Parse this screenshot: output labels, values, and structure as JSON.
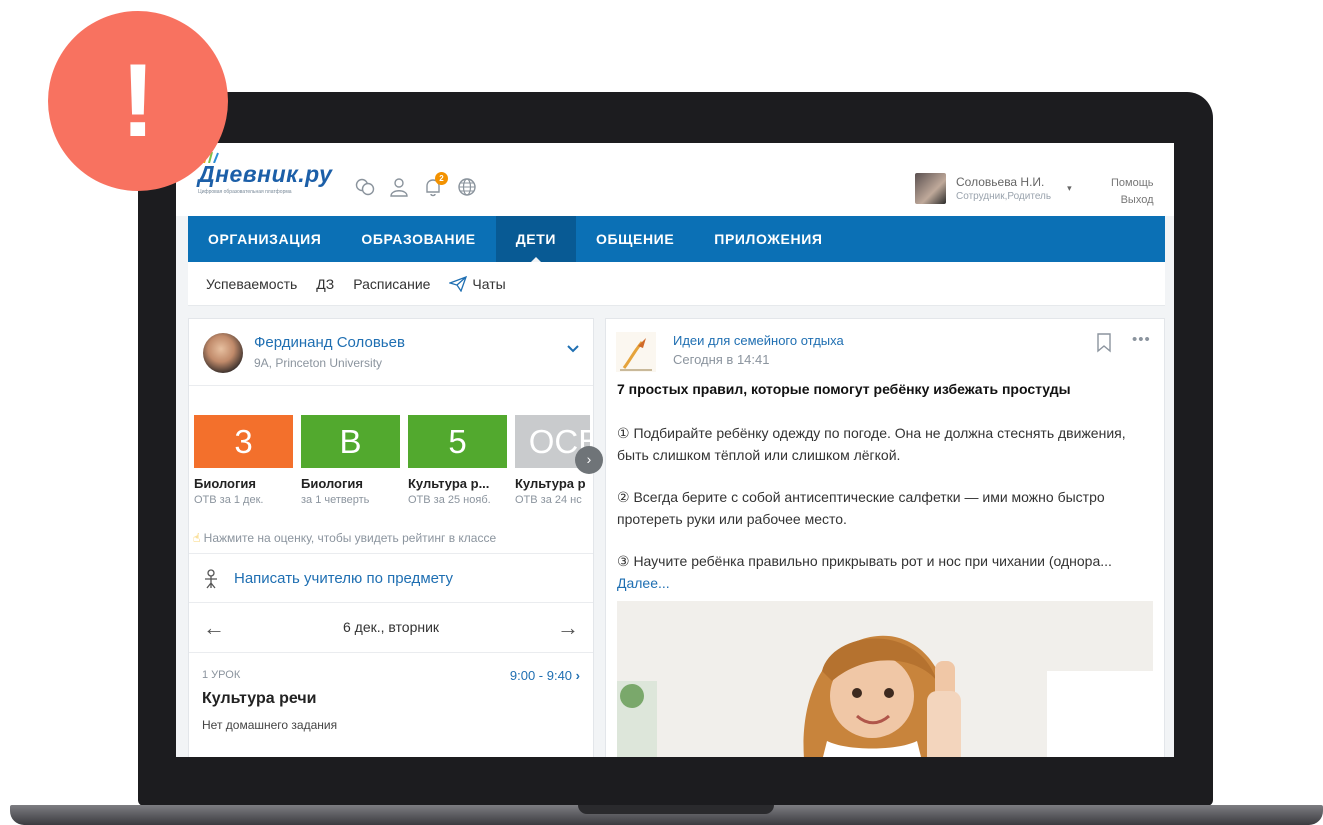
{
  "alert_badge": "!",
  "header": {
    "logo_text": "Дневник.ру",
    "logo_subtitle": "Цифровая образовательная платформа",
    "notifications_count": "2",
    "user_name": "Соловьева Н.И.",
    "user_role": "Сотрудник,Родитель",
    "help": "Помощь",
    "logout": "Выход"
  },
  "nav": {
    "items": [
      "ОРГАНИЗАЦИЯ",
      "ОБРАЗОВАНИЕ",
      "ДЕТИ",
      "ОБЩЕНИЕ",
      "ПРИЛОЖЕНИЯ"
    ],
    "active": "ДЕТИ"
  },
  "subnav": {
    "items": [
      "Успеваемость",
      "ДЗ",
      "Расписание",
      "Чаты"
    ]
  },
  "student": {
    "name": "Фердинанд Соловьев",
    "school": "9А, Princeton University"
  },
  "grades": [
    {
      "mark": "3",
      "subject": "Биология",
      "period": "ОТВ за 1 дек.",
      "color": "#f3702c"
    },
    {
      "mark": "B",
      "subject": "Биология",
      "period": "за 1 четверть",
      "color": "#52a92e"
    },
    {
      "mark": "5",
      "subject": "Культура р...",
      "period": "ОТВ за 25 нояб.",
      "color": "#52a92e"
    },
    {
      "mark": "ОСВ",
      "subject": "Культура р",
      "period": "ОТВ за 24 нс",
      "color": "#c9cbcd"
    }
  ],
  "grades_hint": "Нажмите на оценку, чтобы увидеть рейтинг в классе",
  "write_teacher": "Написать учителю по предмету",
  "schedule": {
    "date": "6 дек., вторник",
    "lesson_number": "1 УРОК",
    "lesson_time": "9:00 - 9:40",
    "lesson_subject": "Культура речи",
    "homework": "Нет домашнего задания"
  },
  "post": {
    "source": "Идеи для семейного отдыха",
    "time": "Сегодня в 14:41",
    "title": "7 простых правил, которые помогут ребёнку избежать простуды",
    "paragraphs": [
      "① Подбирайте ребёнку одежду по погоде. Она не должна стеснять движения, быть слишком тёплой или слишком лёгкой.",
      "② Всегда берите с собой антисептические салфетки — ими можно быстро протереть руки или рабочее место."
    ],
    "paragraph3": "③ Научите ребёнка правильно прикрывать рот и нос при чихании (однора...",
    "more_link": "Далее..."
  },
  "colors": {
    "nav_blue": "#0b70b5",
    "nav_active": "#085a94",
    "link_blue": "#1f6fb2",
    "alert": "#f87260"
  }
}
